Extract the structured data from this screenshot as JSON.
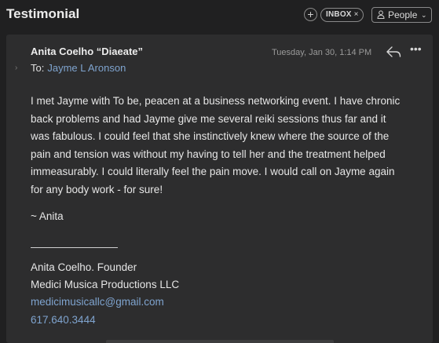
{
  "header": {
    "title": "Testimonial",
    "add_label": "+",
    "label_tag": "INBOX",
    "label_remove": "×",
    "people_label": "People",
    "people_chevron": "⌄"
  },
  "message": {
    "sender": "Anita Coelho “Diaeate”",
    "date": "Tuesday, Jan 30, 1:14 PM",
    "to_label": "To:",
    "recipient": "Jayme L Aronson",
    "more_label": "•••",
    "expand_label": "›",
    "body_paragraph": "I met Jayme with To be, peacen at a business networking event.  I have chronic back problems and had Jayme give me several reiki sessions thus far and it was fabulous.  I could feel that she instinctively knew where the source of the pain and tension was without my having to tell her and the treatment helped immeasurably.  I could literally feel the pain move.   I would call on Jayme again for any body work - for sure!",
    "signoff": "~ Anita",
    "signature": {
      "name": "Anita Coelho. Founder",
      "company": "Medici Musica Productions LLC",
      "email": "medicimusicallc@gmail.com",
      "phone": "617.640.3444"
    }
  },
  "icons": {
    "reply": "reply-icon",
    "more": "more-icon",
    "people": "person-icon"
  },
  "colors": {
    "background": "#202021",
    "card": "#2d2d2e",
    "link": "#7fa4cf",
    "text": "#e6e6e6"
  }
}
